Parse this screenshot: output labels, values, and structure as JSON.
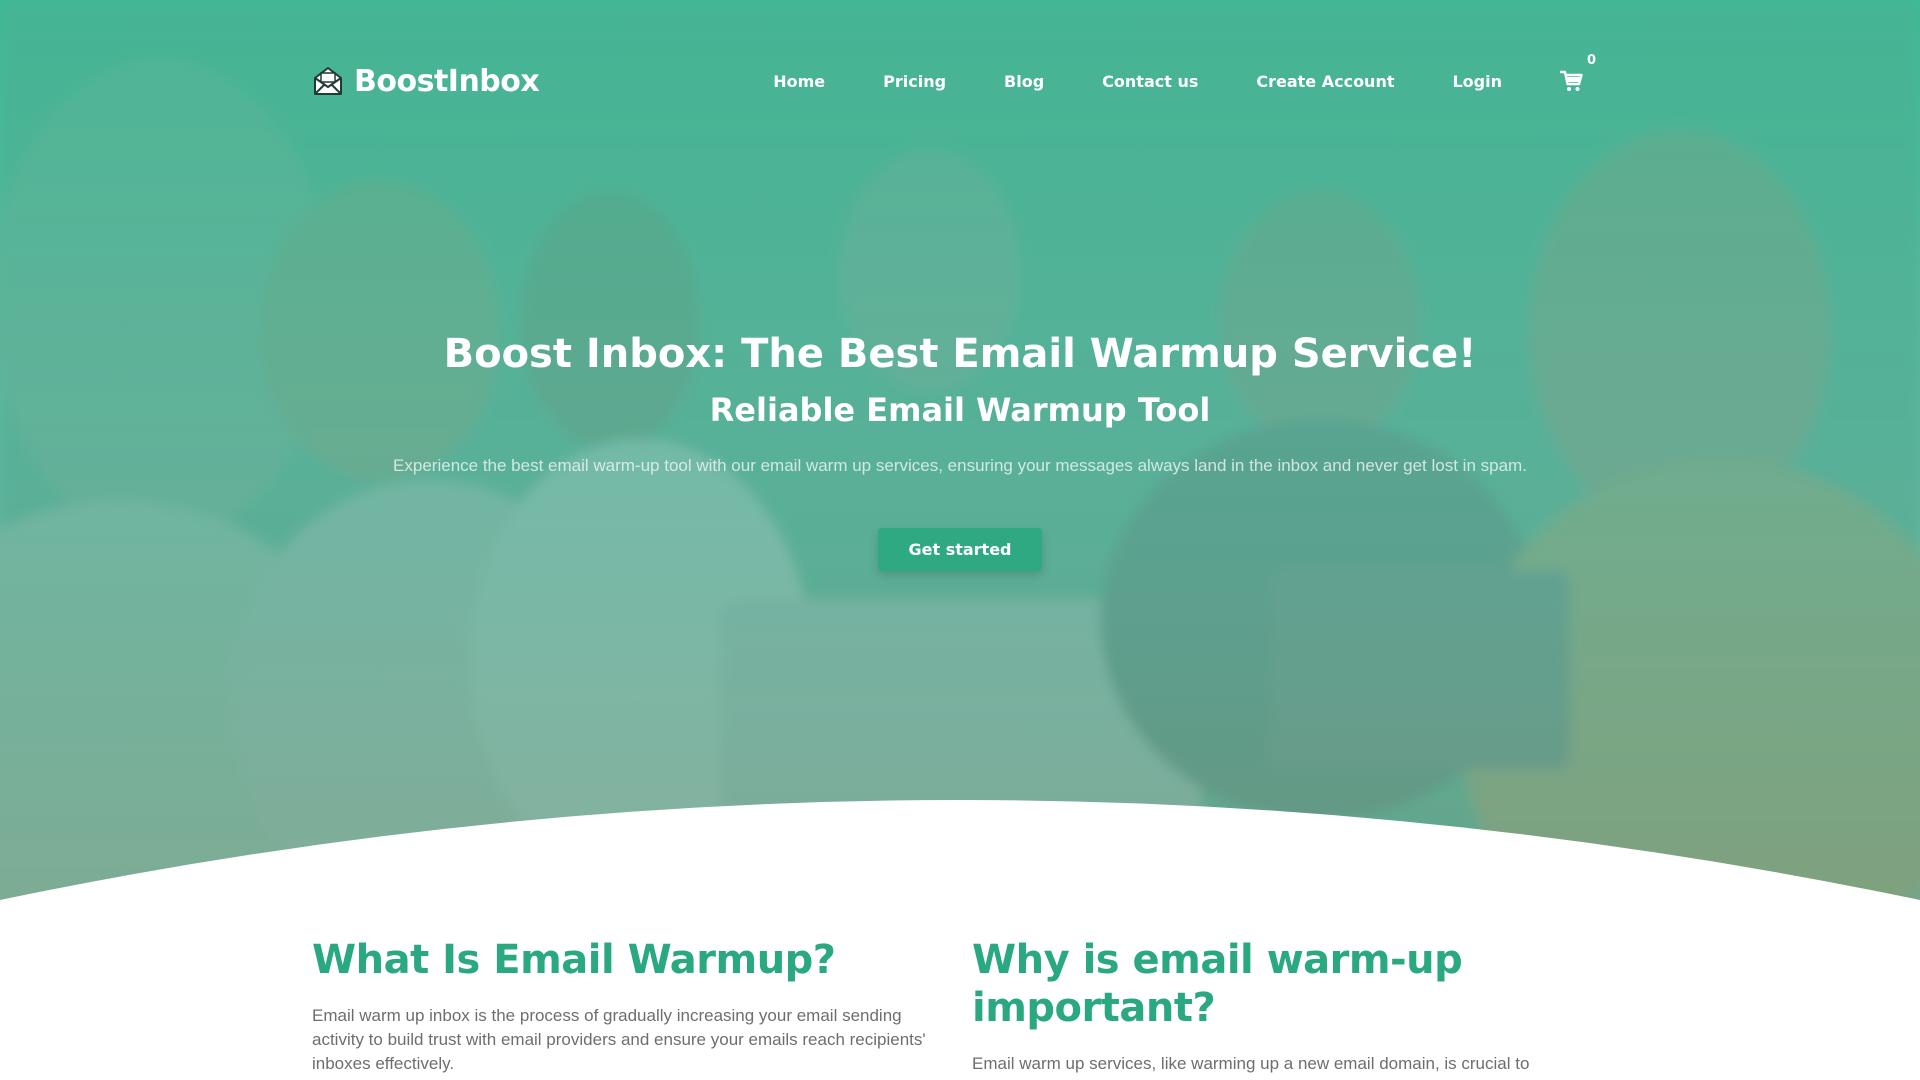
{
  "brand": {
    "name": "BoostInbox",
    "icon": "open-envelope-icon"
  },
  "nav": {
    "links": [
      "Home",
      "Pricing",
      "Blog",
      "Contact us",
      "Create Account",
      "Login"
    ],
    "cart_icon": "shopping-cart-icon",
    "cart_count": "0"
  },
  "hero": {
    "title": "Boost Inbox: The Best Email Warmup Service!",
    "subtitle": "Reliable Email Warmup Tool",
    "description": "Experience the best email warm-up tool with our email warm up services, ensuring your messages always land in the inbox and never get lost in spam.",
    "cta_label": "Get started"
  },
  "sections": {
    "left": {
      "heading": "What Is Email Warmup?",
      "body": "Email warm up inbox is the process of gradually increasing your email sending activity to build trust with email providers and ensure your emails reach recipients' inboxes effectively."
    },
    "right": {
      "heading": "Why is email warm-up important?",
      "body": "Email warm up services, like warming up a new email domain, is crucial to avoid spam filters, build sender reputation, and ensure email deliverability"
    }
  },
  "colors": {
    "primary_green": "#2aa882",
    "button_green": "#2fa982",
    "hero_tint": "#3fb896",
    "body_text": "#6e6e6e"
  }
}
